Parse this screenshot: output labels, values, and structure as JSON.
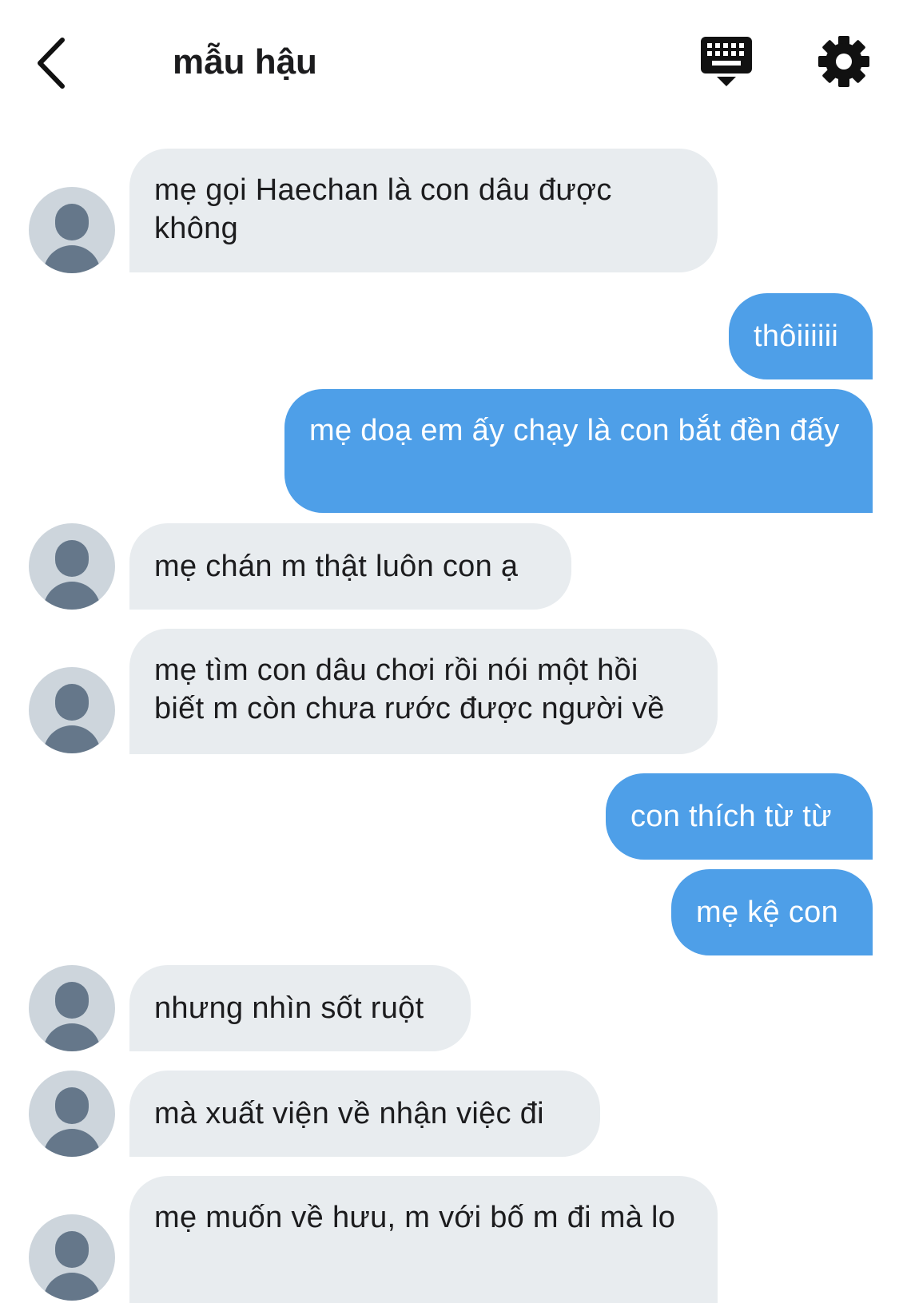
{
  "header": {
    "title": "mẫu hậu"
  },
  "icons": {
    "back": "chevron-left-icon",
    "keyboard": "keyboard-icon",
    "settings": "gear-icon"
  },
  "colors": {
    "incoming_bubble": "#e8ecef",
    "outgoing_bubble": "#4e9fe8",
    "avatar_bg": "#cdd5dc",
    "avatar_fg": "#65778a"
  },
  "messages": [
    {
      "sender": "them",
      "text": "mẹ gọi Haechan là con dâu được không"
    },
    {
      "sender": "me",
      "text": "thôiiiiii"
    },
    {
      "sender": "me",
      "text": "mẹ doạ em ấy chạy là con bắt đền đấy"
    },
    {
      "sender": "them",
      "text": "mẹ chán m thật luôn con ạ"
    },
    {
      "sender": "them",
      "text": "mẹ tìm con dâu chơi rồi nói một hồi biết m còn chưa rước được người về"
    },
    {
      "sender": "me",
      "text": "con thích từ từ"
    },
    {
      "sender": "me",
      "text": "mẹ kệ con"
    },
    {
      "sender": "them",
      "text": "nhưng nhìn sốt ruột"
    },
    {
      "sender": "them",
      "text": "mà xuất viện về nhận việc đi"
    },
    {
      "sender": "them",
      "text": "mẹ muốn về hưu, m với bố m đi mà lo"
    }
  ]
}
